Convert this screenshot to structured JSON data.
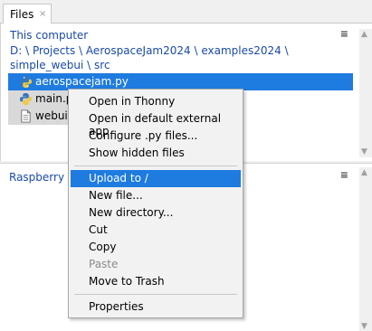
{
  "tab": {
    "label": "Files",
    "close": "×"
  },
  "local": {
    "title": "This computer",
    "path": "D: \\ Projects \\ AerospaceJam2024 \\ examples2024 \\ simple_webui \\ src",
    "menu_glyph": "≡",
    "files": [
      {
        "name": "aerospacejam.py",
        "icon": "python-file-icon",
        "state": "selected"
      },
      {
        "name": "main.p",
        "icon": "python-file-icon",
        "state": "highlighted"
      },
      {
        "name": "webui.",
        "icon": "text-file-icon",
        "state": "highlighted"
      }
    ]
  },
  "remote": {
    "title": "Raspberry Pi",
    "menu_glyph": "≡"
  },
  "context_menu": {
    "items": [
      {
        "label": "Open in Thonny"
      },
      {
        "label": "Open in default external app"
      },
      {
        "label": "Configure .py files..."
      },
      {
        "label": "Show hidden files"
      },
      {
        "label": "Upload to /"
      },
      {
        "label": "New file..."
      },
      {
        "label": "New directory..."
      },
      {
        "label": "Cut"
      },
      {
        "label": "Copy"
      },
      {
        "label": "Paste",
        "disabled": true
      },
      {
        "label": "Move to Trash"
      },
      {
        "label": "Properties"
      }
    ]
  },
  "colors": {
    "selection": "#1e7be0",
    "link": "#1a4aa8"
  }
}
